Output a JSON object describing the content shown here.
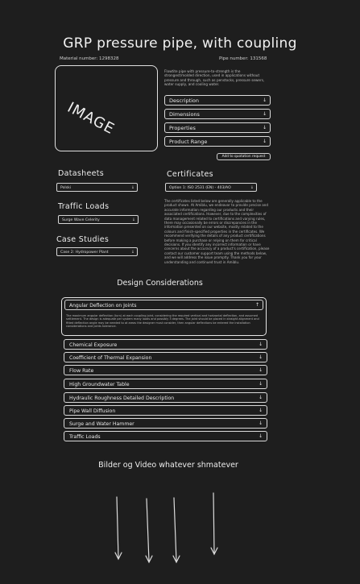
{
  "product": {
    "title": "GRP pressure pipe, with coupling",
    "material_number": "Material number: 1298328",
    "pipe_number": "Pipe number: 131568",
    "image_placeholder": "IMAGE",
    "description": "Flowtite pipe with pressure-to-strength is the strongest/molded direction, used in applications without pressure and through, such as penstocks, pressure sewers, water supply, and cooling water."
  },
  "sections": [
    {
      "label": "Description"
    },
    {
      "label": "Dimensions"
    },
    {
      "label": "Properties"
    },
    {
      "label": "Product Range"
    }
  ],
  "quotation_button": "Add to quotation request",
  "datasheets": {
    "heading": "Datasheets",
    "selected": "Polski"
  },
  "traffic_loads": {
    "heading": "Traffic Loads",
    "selected": "Surge Wave Celerity"
  },
  "case_studies": {
    "heading": "Case Studies",
    "selected": "Case 2: Hydropower Plant"
  },
  "certificates": {
    "heading": "Certificates",
    "selected": "Option 1: ISO 2531 (EN) - 403/AO",
    "disclaimer": "The certificates listed below are generally applicable to the product shown. At Amiblu, we endeavor to provide precise and accurate information regarding our products and their associated certifications. However, due to the complexities of data management related to certifications and varying rules, there may occasionally be errors or discrepancies in the information presented on our website, mostly related to the colours and finish-specified properties in the certificates. We recommend verifying the details of any product certifications before making a purchase or relying on them for critical decisions. If you identify any incorrect information or have concerns about the accuracy of a product's certification, please contact our customer support team using the methods below, and we will address the issue promptly. Thank you for your understanding and continued trust in Amiblu."
  },
  "design_considerations": {
    "heading": "Design Considerations",
    "open_item": {
      "label": "Angular Deflection on Joints",
      "body": "The maximum angular deflection (turn) at each coupling joint, considering the required vertical and horizontal deflection, and assumed settlement. The design is adequate per system many loads and possibly 3 degrees. The joint should be placed in straight alignment and fitted deflection angle may be needed to at areas the designer must consider, then angular deflections be entered the installation considerations and joints tolerance."
    },
    "items": [
      {
        "label": "Chemical Exposure"
      },
      {
        "label": "Coefficient of Thermal Expansion"
      },
      {
        "label": "Flow Rate"
      },
      {
        "label": "High Groundwater Table"
      },
      {
        "label": "Hydraulic Roughness Detailed Description"
      },
      {
        "label": "Pipe Wall Diffusion"
      },
      {
        "label": "Surge and Water Hammer"
      },
      {
        "label": "Traffic Loads"
      }
    ]
  },
  "media": {
    "heading": "Bilder og Video whatever shmatever"
  }
}
